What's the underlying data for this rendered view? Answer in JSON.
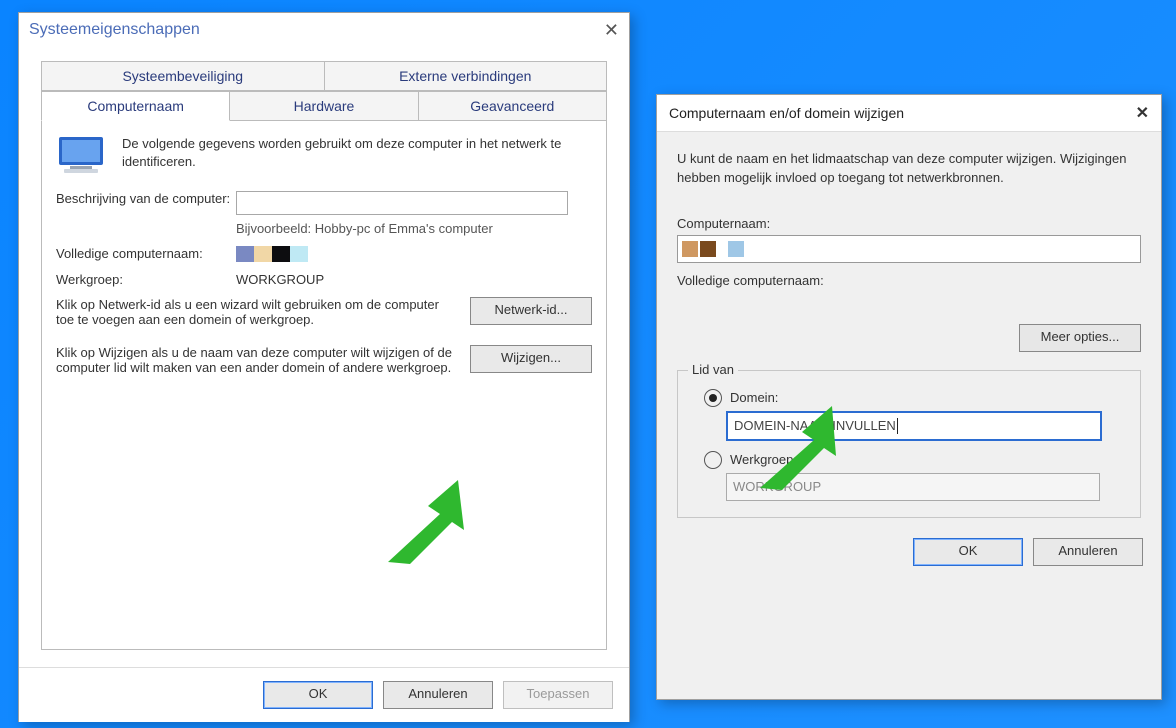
{
  "w1": {
    "title": "Systeemeigenschappen",
    "tabsRow1": [
      "Systeembeveiliging",
      "Externe verbindingen"
    ],
    "tabsRow2": [
      "Computernaam",
      "Hardware",
      "Geavanceerd"
    ],
    "intro": "De volgende gegevens worden gebruikt om deze computer in het netwerk te identificeren.",
    "descLabel": "Beschrijving van de computer:",
    "descHint": "Bijvoorbeeld: Hobby-pc of Emma's computer",
    "fullLabel": "Volledige computernaam:",
    "wgLabel": "Werkgroep:",
    "wgValue": "WORKGROUP",
    "para1": "Klik op Netwerk-id als u een wizard wilt gebruiken om de computer toe te voegen aan een domein of werkgroep.",
    "btnNetId": "Netwerk-id...",
    "para2": "Klik op Wijzigen als u de naam van deze computer wilt wijzigen of de computer lid wilt maken van een ander domein of andere werkgroep.",
    "btnChange": "Wijzigen...",
    "ok": "OK",
    "cancel": "Annuleren",
    "apply": "Toepassen",
    "swatches": [
      "#7a89c2",
      "#f1d7a6",
      "#0d0d10",
      "#bfe9f4"
    ]
  },
  "w2": {
    "title": "Computernaam en/of domein wijzigen",
    "intro": "U kunt de naam en het lidmaatschap van deze computer wijzigen. Wijzigingen hebben mogelijk invloed op toegang tot netwerkbronnen.",
    "nameLabel": "Computernaam:",
    "fullLabel": "Volledige computernaam:",
    "moreOpts": "Meer opties...",
    "legend": "Lid van",
    "radioDomain": "Domein:",
    "domainValue": "DOMEIN-NAAM-INVULLEN",
    "radioWg": "Werkgroep:",
    "wgValue": "WORKGROUP",
    "ok": "OK",
    "cancel": "Annuleren",
    "swatches": [
      "#cf9861",
      "#7a4a1e",
      "#9fc7e6"
    ]
  }
}
